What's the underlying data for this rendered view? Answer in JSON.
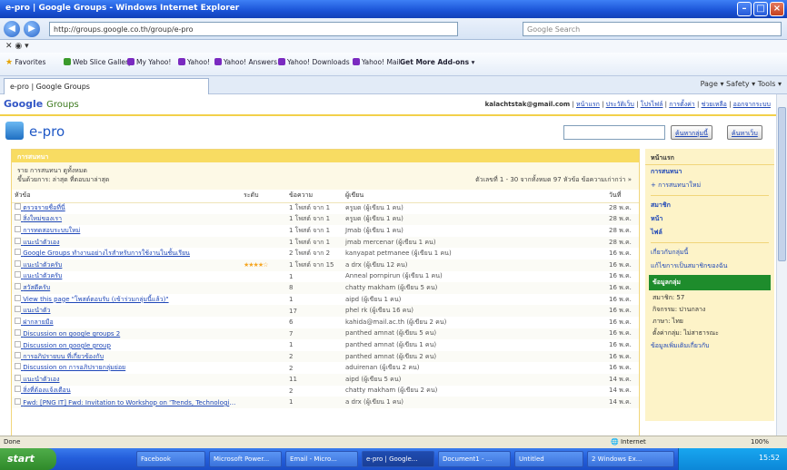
{
  "window": {
    "title": "e-pro | Google Groups - Windows Internet Explorer"
  },
  "browser": {
    "url": "http://groups.google.co.th/group/e-pro",
    "search_placeholder": "Google Search",
    "favorites_label": "Favorites",
    "favorites": [
      "Web Slice Gallery",
      "My Yahoo!",
      "Yahoo!",
      "Yahoo! Answers",
      "Yahoo! Downloads",
      "Yahoo! Mail",
      "Get More Add-ons"
    ],
    "tab_title": "e-pro | Google Groups",
    "tools": "Page ▾  Safety ▾  Tools ▾"
  },
  "google": {
    "logo": "Google",
    "logo_suffix": "Groups",
    "account_email": "kalachtstak@gmail.com",
    "top_links": [
      "หน้าแรก",
      "ประวัติเว็บ",
      "โปรไฟล์",
      "การตั้งค่า",
      "ช่วยเหลือ",
      "ออกจากระบบ"
    ]
  },
  "group": {
    "name": "e-pro",
    "search_button": "ค้นหากลุ่มนี้",
    "search_web_button": "ค้นหาเว็บ"
  },
  "main": {
    "header": "การสนทนา",
    "meta_line1": "ราย การสนทนา ดูทั้งหมด",
    "meta_line2": "ขึ้นด้วยการ: ล่าสุด ที่ตอบมาล่าสุด",
    "pagination": "ตัวเลขที่ 1 - 30 จากทั้งหมด 97 หัวข้อ  ข้อความเก่ากว่า »",
    "columns": [
      "หัวข้อ",
      "ระดับ",
      "ข้อความ",
      "ผู้เขียน",
      "วันที่"
    ],
    "rows": [
      {
        "title": "ตรวจรายชื่อที่นี่",
        "rating": "",
        "msgs": "1 โพสต์ จาก 1",
        "author": "ครูมด (ผู้เขียน 1 คน)",
        "date": "28 พ.ค."
      },
      {
        "title": "สิ่งใหม่ของเรา",
        "rating": "",
        "msgs": "1 โพสต์ จาก 1",
        "author": "ครูมด (ผู้เขียน 1 คน)",
        "date": "28 พ.ค."
      },
      {
        "title": "การทดสอบระบบใหม่",
        "rating": "",
        "msgs": "1 โพสต์ จาก 1",
        "author": "Jmab (ผู้เขียน 1 คน)",
        "date": "28 พ.ค."
      },
      {
        "title": "แนะนำตัวเอง",
        "rating": "",
        "msgs": "1 โพสต์ จาก 1",
        "author": "jmab mercenar (ผู้เขียน 1 คน)",
        "date": "28 พ.ค."
      },
      {
        "title": "Google Groups ทำงานอย่างไรสำหรับการใช้งานในชั้นเรียน",
        "rating": "",
        "msgs": "2 โพสต์ จาก 2",
        "author": "kanyapat petmanee (ผู้เขียน 1 คน)",
        "date": "16 พ.ค."
      },
      {
        "title": "แนะนำตัวครับ",
        "rating": "★★★★☆",
        "msgs": "1 โพสต์ จาก 15",
        "author": "a drx (ผู้เขียน 12 คน)",
        "date": "16 พ.ค."
      },
      {
        "title": "แนะนำตัวครับ",
        "rating": "",
        "msgs": "1",
        "author": "Anneal pornpirun (ผู้เขียน 1 คน)",
        "date": "16 พ.ค."
      },
      {
        "title": "สวัสดีครับ",
        "rating": "",
        "msgs": "8",
        "author": "chatty makham (ผู้เขียน 5 คน)",
        "date": "16 พ.ค."
      },
      {
        "title": "View this page \"โพสต์ตอบรับ (เข้าร่วมกลุ่มนี้แล้ว)\"",
        "rating": "",
        "msgs": "1",
        "author": "aipd (ผู้เขียน 1 คน)",
        "date": "16 พ.ค."
      },
      {
        "title": "แนะนำตัว",
        "rating": "",
        "msgs": "17",
        "author": "phel rk (ผู้เขียน 16 คน)",
        "date": "16 พ.ค."
      },
      {
        "title": "ฝากลายมือ",
        "rating": "",
        "msgs": "6",
        "author": "kahida@mail.ac.th (ผู้เขียน 2 คน)",
        "date": "16 พ.ค."
      },
      {
        "title": "Discussion on google groups 2",
        "rating": "",
        "msgs": "7",
        "author": "panthed amnat (ผู้เขียน 5 คน)",
        "date": "16 พ.ค."
      },
      {
        "title": "Discussion on google group",
        "rating": "",
        "msgs": "1",
        "author": "panthed amnat (ผู้เขียน 1 คน)",
        "date": "16 พ.ค."
      },
      {
        "title": "การอภิปรายบน ที่เกี่ยวข้องกับ",
        "rating": "",
        "msgs": "2",
        "author": "panthed amnat (ผู้เขียน 2 คน)",
        "date": "16 พ.ค."
      },
      {
        "title": "Discussion on การอภิปรายกลุ่มย่อย",
        "rating": "",
        "msgs": "2",
        "author": "aduirenan (ผู้เขียน 2 คน)",
        "date": "16 พ.ค."
      },
      {
        "title": "แนะนำตัวเอง",
        "rating": "",
        "msgs": "11",
        "author": "aipd (ผู้เขียน 5 คน)",
        "date": "14 พ.ค."
      },
      {
        "title": "สิ่งที่ต้องแจ้งเตือน",
        "rating": "",
        "msgs": "2",
        "author": "chatty makham (ผู้เขียน 2 คน)",
        "date": "14 พ.ค."
      },
      {
        "title": "Fwd: [PNG IT] Fwd: Invitation to Workshop on 'Trends, Technologies and",
        "rating": "",
        "msgs": "1",
        "author": "a drx (ผู้เขียน 1 คน)",
        "date": "14 พ.ค."
      }
    ]
  },
  "sidebar": {
    "header": "หน้าแรก",
    "items": [
      {
        "label": "การสนทนา",
        "bold": true
      },
      {
        "label": "+ การสนทนาใหม่",
        "bold": false
      },
      {
        "label": "สมาชิก",
        "bold": true
      },
      {
        "label": "หน้า",
        "bold": true
      },
      {
        "label": "ไฟล์",
        "bold": true
      },
      {
        "label": "เกี่ยวกับกลุ่มนี้",
        "bold": false
      },
      {
        "label": "แก้ไขการเป็นสมาชิกของฉัน",
        "bold": false
      }
    ],
    "box_title": "ข้อมูลกลุ่ม",
    "box_items": [
      "สมาชิก: 57",
      "กิจกรรม: ปานกลาง",
      "ภาษา: ไทย",
      "ตั้งค่ากลุ่ม: ไม่สาธารณะ"
    ],
    "box_links": [
      "ข้อมูลเพิ่มเติมเกี่ยวกับ"
    ]
  },
  "status": {
    "left": "Done",
    "zone": "Internet",
    "zoom": "100%"
  },
  "taskbar": {
    "start": "start",
    "buttons": [
      "Facebook",
      "Microsoft Power...",
      "Email - Micro...",
      "e-pro | Google...",
      "Document1 - ...",
      "Untitled",
      "2 Windows Ex..."
    ],
    "clock": "15:52"
  }
}
